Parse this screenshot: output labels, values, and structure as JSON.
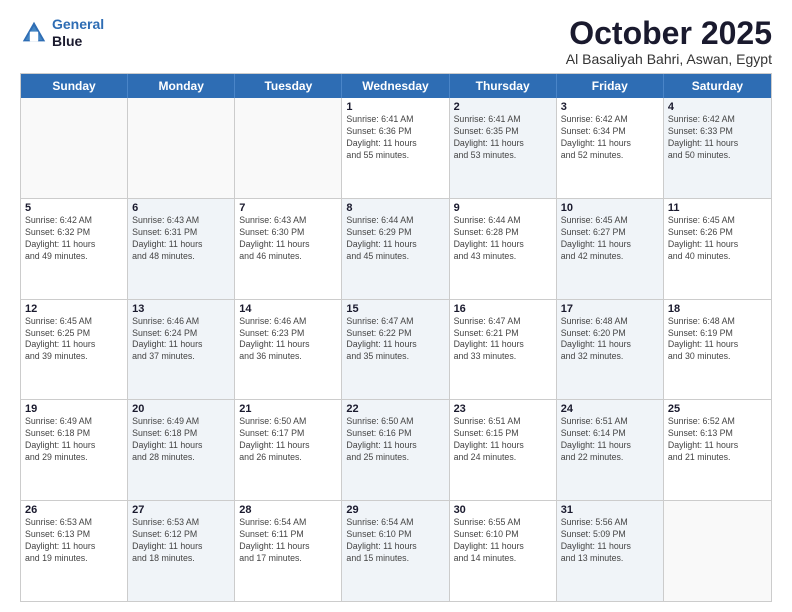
{
  "logo": {
    "line1": "General",
    "line2": "Blue"
  },
  "title": "October 2025",
  "subtitle": "Al Basaliyah Bahri, Aswan, Egypt",
  "header_days": [
    "Sunday",
    "Monday",
    "Tuesday",
    "Wednesday",
    "Thursday",
    "Friday",
    "Saturday"
  ],
  "rows": [
    [
      {
        "day": "",
        "info": "",
        "shaded": false,
        "empty": true
      },
      {
        "day": "",
        "info": "",
        "shaded": false,
        "empty": true
      },
      {
        "day": "",
        "info": "",
        "shaded": false,
        "empty": true
      },
      {
        "day": "1",
        "info": "Sunrise: 6:41 AM\nSunset: 6:36 PM\nDaylight: 11 hours\nand 55 minutes.",
        "shaded": false,
        "empty": false
      },
      {
        "day": "2",
        "info": "Sunrise: 6:41 AM\nSunset: 6:35 PM\nDaylight: 11 hours\nand 53 minutes.",
        "shaded": true,
        "empty": false
      },
      {
        "day": "3",
        "info": "Sunrise: 6:42 AM\nSunset: 6:34 PM\nDaylight: 11 hours\nand 52 minutes.",
        "shaded": false,
        "empty": false
      },
      {
        "day": "4",
        "info": "Sunrise: 6:42 AM\nSunset: 6:33 PM\nDaylight: 11 hours\nand 50 minutes.",
        "shaded": true,
        "empty": false
      }
    ],
    [
      {
        "day": "5",
        "info": "Sunrise: 6:42 AM\nSunset: 6:32 PM\nDaylight: 11 hours\nand 49 minutes.",
        "shaded": false,
        "empty": false
      },
      {
        "day": "6",
        "info": "Sunrise: 6:43 AM\nSunset: 6:31 PM\nDaylight: 11 hours\nand 48 minutes.",
        "shaded": true,
        "empty": false
      },
      {
        "day": "7",
        "info": "Sunrise: 6:43 AM\nSunset: 6:30 PM\nDaylight: 11 hours\nand 46 minutes.",
        "shaded": false,
        "empty": false
      },
      {
        "day": "8",
        "info": "Sunrise: 6:44 AM\nSunset: 6:29 PM\nDaylight: 11 hours\nand 45 minutes.",
        "shaded": true,
        "empty": false
      },
      {
        "day": "9",
        "info": "Sunrise: 6:44 AM\nSunset: 6:28 PM\nDaylight: 11 hours\nand 43 minutes.",
        "shaded": false,
        "empty": false
      },
      {
        "day": "10",
        "info": "Sunrise: 6:45 AM\nSunset: 6:27 PM\nDaylight: 11 hours\nand 42 minutes.",
        "shaded": true,
        "empty": false
      },
      {
        "day": "11",
        "info": "Sunrise: 6:45 AM\nSunset: 6:26 PM\nDaylight: 11 hours\nand 40 minutes.",
        "shaded": false,
        "empty": false
      }
    ],
    [
      {
        "day": "12",
        "info": "Sunrise: 6:45 AM\nSunset: 6:25 PM\nDaylight: 11 hours\nand 39 minutes.",
        "shaded": false,
        "empty": false
      },
      {
        "day": "13",
        "info": "Sunrise: 6:46 AM\nSunset: 6:24 PM\nDaylight: 11 hours\nand 37 minutes.",
        "shaded": true,
        "empty": false
      },
      {
        "day": "14",
        "info": "Sunrise: 6:46 AM\nSunset: 6:23 PM\nDaylight: 11 hours\nand 36 minutes.",
        "shaded": false,
        "empty": false
      },
      {
        "day": "15",
        "info": "Sunrise: 6:47 AM\nSunset: 6:22 PM\nDaylight: 11 hours\nand 35 minutes.",
        "shaded": true,
        "empty": false
      },
      {
        "day": "16",
        "info": "Sunrise: 6:47 AM\nSunset: 6:21 PM\nDaylight: 11 hours\nand 33 minutes.",
        "shaded": false,
        "empty": false
      },
      {
        "day": "17",
        "info": "Sunrise: 6:48 AM\nSunset: 6:20 PM\nDaylight: 11 hours\nand 32 minutes.",
        "shaded": true,
        "empty": false
      },
      {
        "day": "18",
        "info": "Sunrise: 6:48 AM\nSunset: 6:19 PM\nDaylight: 11 hours\nand 30 minutes.",
        "shaded": false,
        "empty": false
      }
    ],
    [
      {
        "day": "19",
        "info": "Sunrise: 6:49 AM\nSunset: 6:18 PM\nDaylight: 11 hours\nand 29 minutes.",
        "shaded": false,
        "empty": false
      },
      {
        "day": "20",
        "info": "Sunrise: 6:49 AM\nSunset: 6:18 PM\nDaylight: 11 hours\nand 28 minutes.",
        "shaded": true,
        "empty": false
      },
      {
        "day": "21",
        "info": "Sunrise: 6:50 AM\nSunset: 6:17 PM\nDaylight: 11 hours\nand 26 minutes.",
        "shaded": false,
        "empty": false
      },
      {
        "day": "22",
        "info": "Sunrise: 6:50 AM\nSunset: 6:16 PM\nDaylight: 11 hours\nand 25 minutes.",
        "shaded": true,
        "empty": false
      },
      {
        "day": "23",
        "info": "Sunrise: 6:51 AM\nSunset: 6:15 PM\nDaylight: 11 hours\nand 24 minutes.",
        "shaded": false,
        "empty": false
      },
      {
        "day": "24",
        "info": "Sunrise: 6:51 AM\nSunset: 6:14 PM\nDaylight: 11 hours\nand 22 minutes.",
        "shaded": true,
        "empty": false
      },
      {
        "day": "25",
        "info": "Sunrise: 6:52 AM\nSunset: 6:13 PM\nDaylight: 11 hours\nand 21 minutes.",
        "shaded": false,
        "empty": false
      }
    ],
    [
      {
        "day": "26",
        "info": "Sunrise: 6:53 AM\nSunset: 6:13 PM\nDaylight: 11 hours\nand 19 minutes.",
        "shaded": false,
        "empty": false
      },
      {
        "day": "27",
        "info": "Sunrise: 6:53 AM\nSunset: 6:12 PM\nDaylight: 11 hours\nand 18 minutes.",
        "shaded": true,
        "empty": false
      },
      {
        "day": "28",
        "info": "Sunrise: 6:54 AM\nSunset: 6:11 PM\nDaylight: 11 hours\nand 17 minutes.",
        "shaded": false,
        "empty": false
      },
      {
        "day": "29",
        "info": "Sunrise: 6:54 AM\nSunset: 6:10 PM\nDaylight: 11 hours\nand 15 minutes.",
        "shaded": true,
        "empty": false
      },
      {
        "day": "30",
        "info": "Sunrise: 6:55 AM\nSunset: 6:10 PM\nDaylight: 11 hours\nand 14 minutes.",
        "shaded": false,
        "empty": false
      },
      {
        "day": "31",
        "info": "Sunrise: 5:56 AM\nSunset: 5:09 PM\nDaylight: 11 hours\nand 13 minutes.",
        "shaded": true,
        "empty": false
      },
      {
        "day": "",
        "info": "",
        "shaded": false,
        "empty": true
      }
    ]
  ]
}
